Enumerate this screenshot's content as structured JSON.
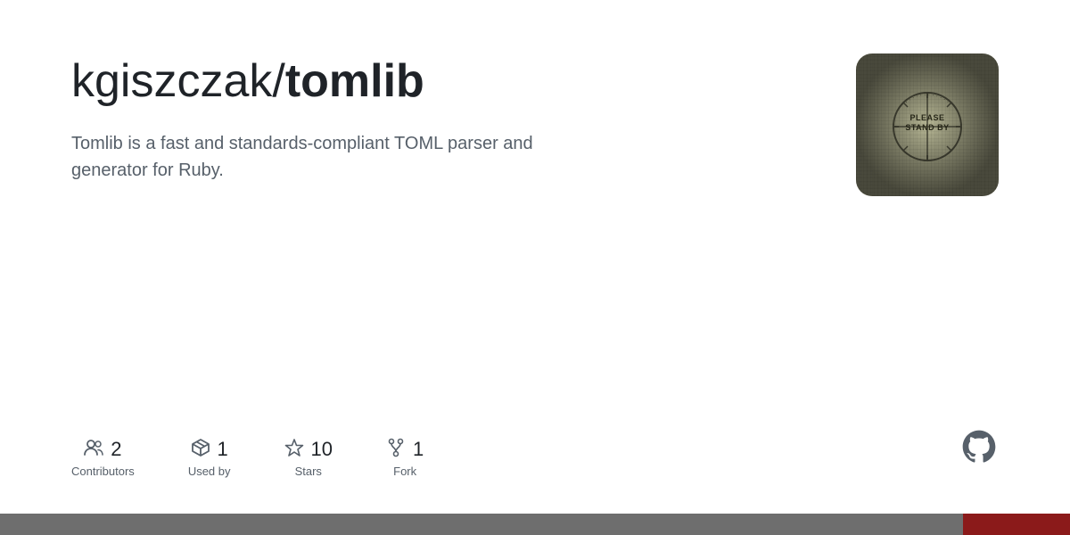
{
  "repo": {
    "owner": "kgiszczak/",
    "name": "tomlib",
    "description": "Tomlib is a fast and standards-compliant TOML parser and generator for Ruby."
  },
  "stats": [
    {
      "id": "contributors",
      "count": "2",
      "label": "Contributors",
      "icon": "people-icon"
    },
    {
      "id": "used-by",
      "count": "1",
      "label": "Used by",
      "icon": "package-icon"
    },
    {
      "id": "stars",
      "count": "10",
      "label": "Stars",
      "icon": "star-icon"
    },
    {
      "id": "fork",
      "count": "1",
      "label": "Fork",
      "icon": "fork-icon"
    }
  ],
  "avatar": {
    "alt": "Please Stand By TV test pattern"
  }
}
